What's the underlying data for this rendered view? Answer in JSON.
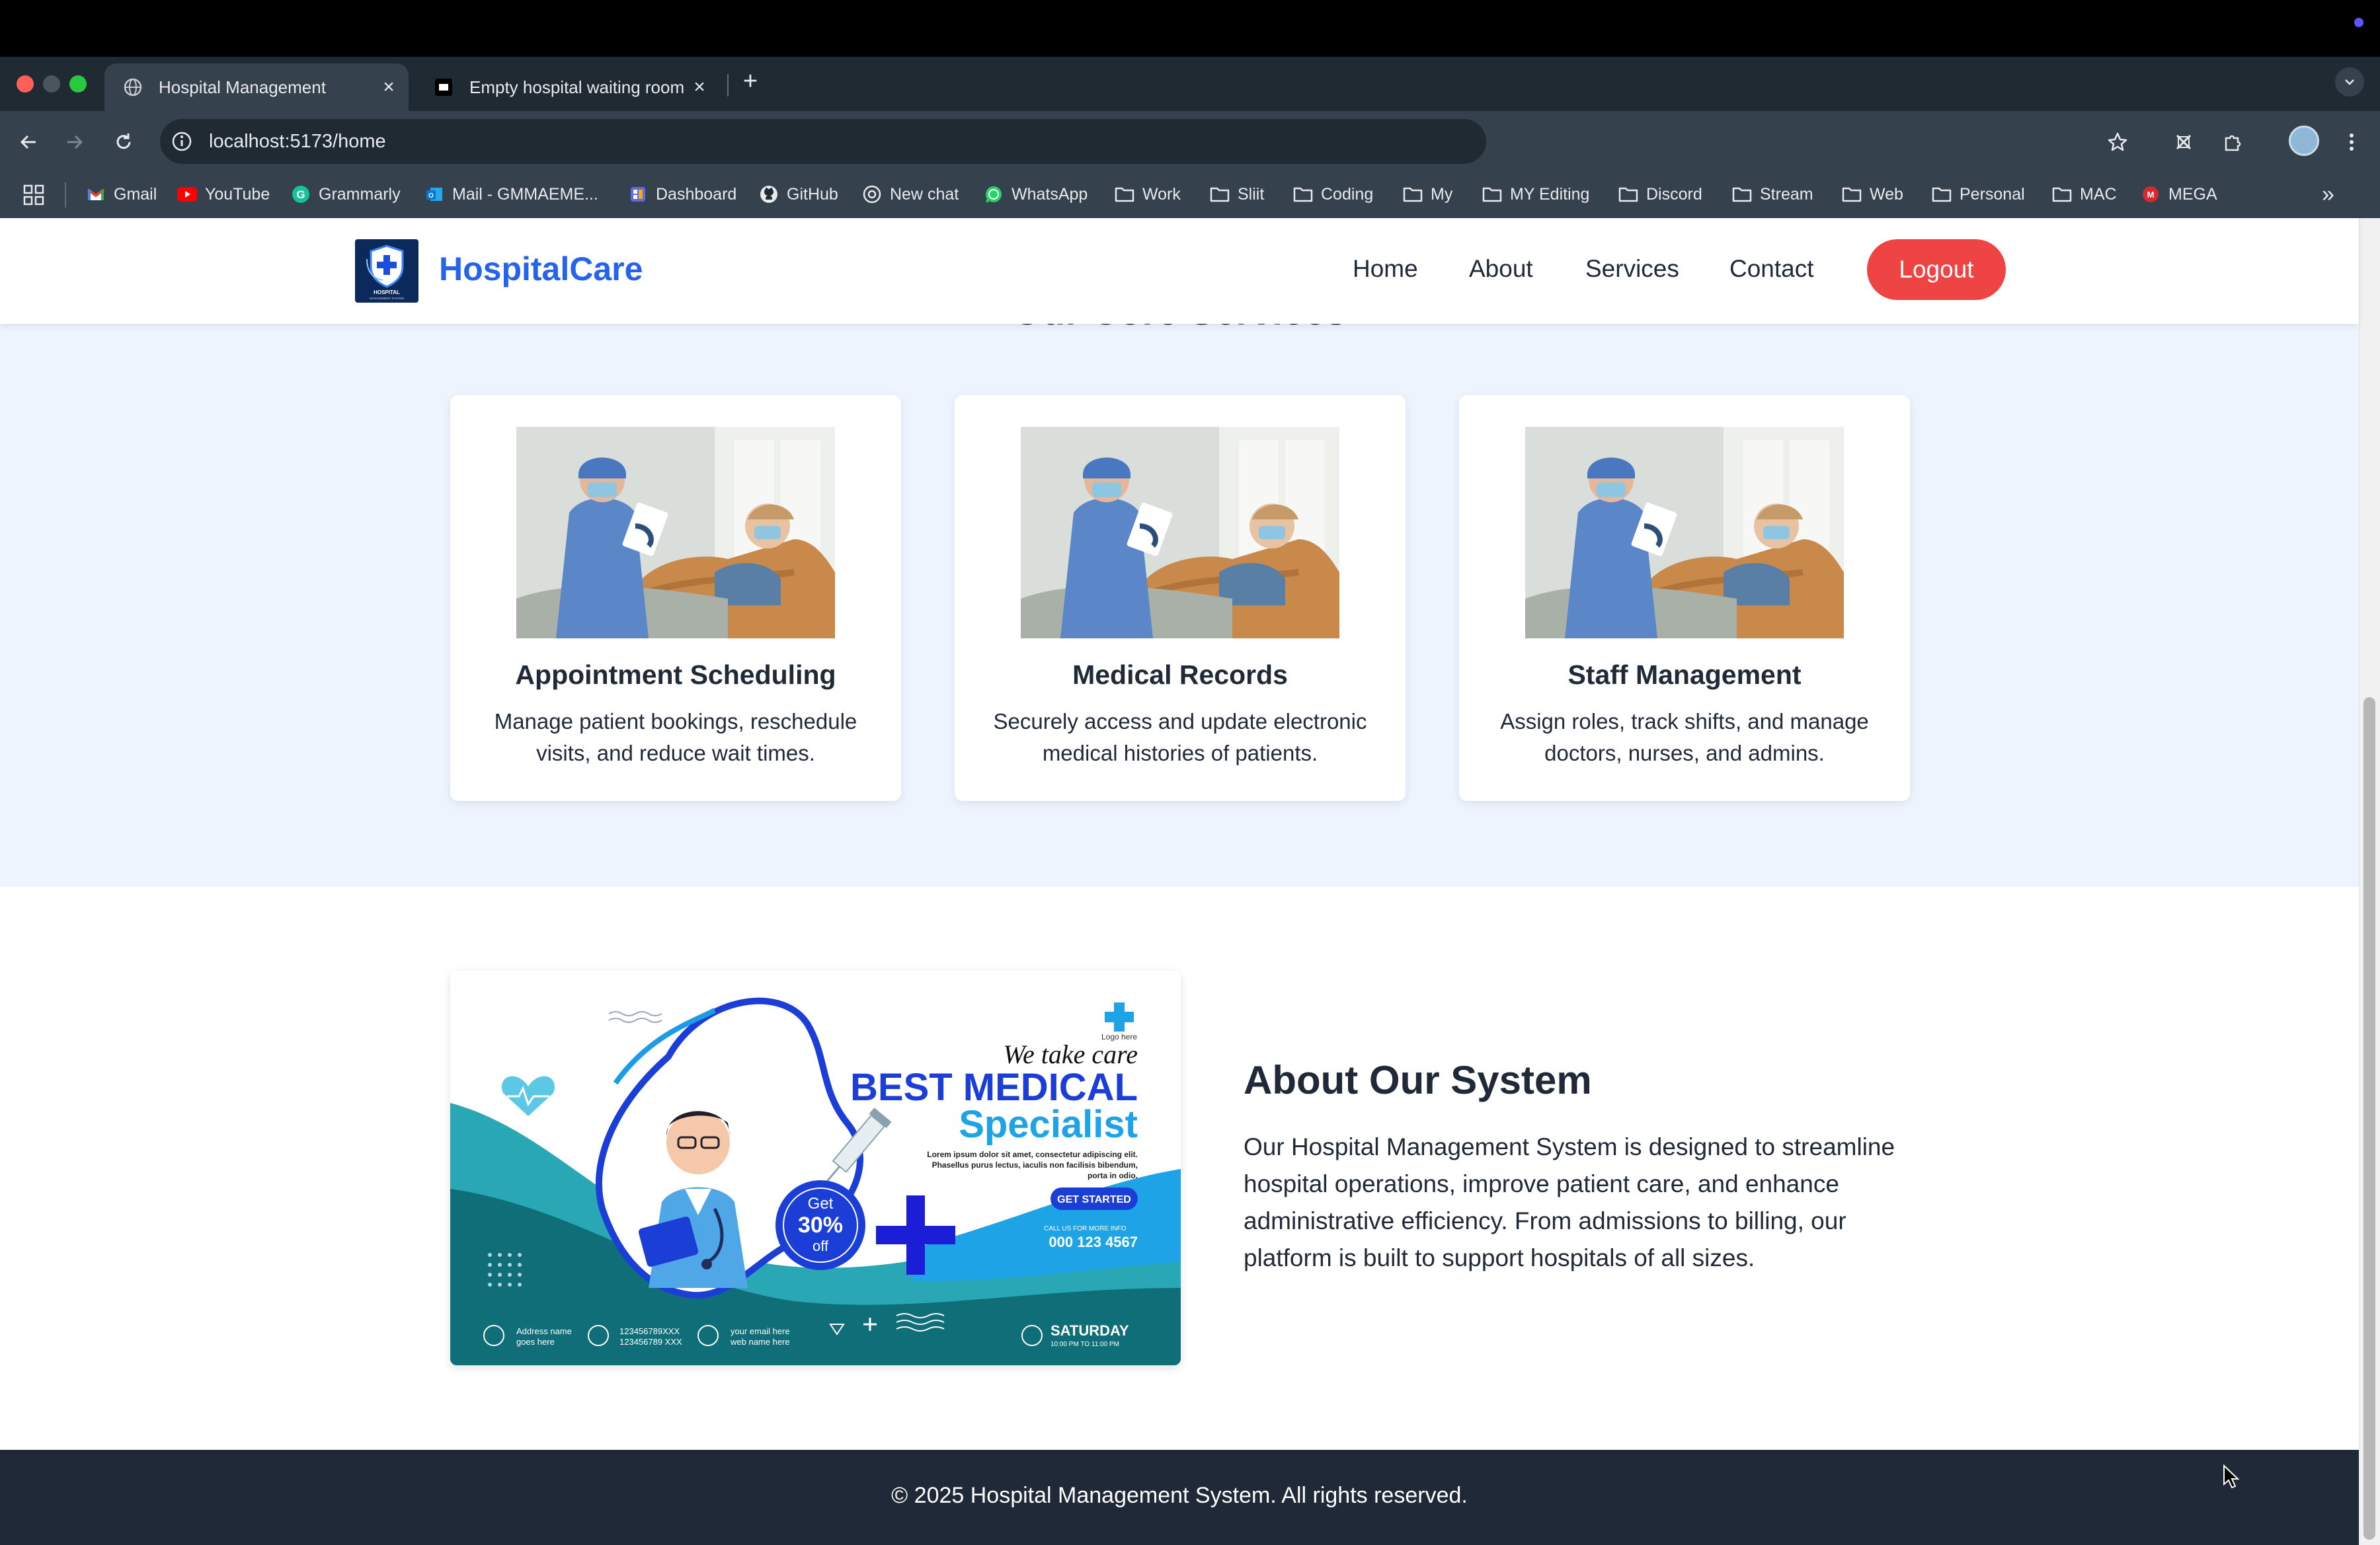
{
  "browser": {
    "tabs": [
      {
        "title": "Hospital Management",
        "active": true
      },
      {
        "title": "Empty hospital waiting room",
        "active": false
      }
    ],
    "new_tab_label": "+",
    "url": "localhost:5173/home",
    "bookmarks": [
      {
        "label": "Gmail",
        "icon": "gmail-icon"
      },
      {
        "label": "YouTube",
        "icon": "youtube-icon"
      },
      {
        "label": "Grammarly",
        "icon": "grammarly-icon"
      },
      {
        "label": "Mail - GMMAEME...",
        "icon": "outlook-icon"
      },
      {
        "label": "Dashboard",
        "icon": "dashboard-icon"
      },
      {
        "label": "GitHub",
        "icon": "github-icon"
      },
      {
        "label": "New chat",
        "icon": "chatgpt-icon"
      },
      {
        "label": "WhatsApp",
        "icon": "whatsapp-icon"
      },
      {
        "label": "Work",
        "icon": "folder-icon"
      },
      {
        "label": "Sliit",
        "icon": "folder-icon"
      },
      {
        "label": "Coding",
        "icon": "folder-icon"
      },
      {
        "label": "My",
        "icon": "folder-icon"
      },
      {
        "label": "MY Editing",
        "icon": "folder-icon"
      },
      {
        "label": "Discord",
        "icon": "folder-icon"
      },
      {
        "label": "Stream",
        "icon": "folder-icon"
      },
      {
        "label": "Web",
        "icon": "folder-icon"
      },
      {
        "label": "Personal",
        "icon": "folder-icon"
      },
      {
        "label": "MAC",
        "icon": "folder-icon"
      },
      {
        "label": "MEGA",
        "icon": "mega-icon"
      }
    ],
    "overflow_label": "»"
  },
  "header": {
    "logo_text": "HOSPITAL",
    "logo_subtext": "MANAGEMENT SYSTEM",
    "brand": "HospitalCare",
    "nav": [
      "Home",
      "About",
      "Services",
      "Contact"
    ],
    "logout_label": "Logout"
  },
  "services": {
    "section_title": "Our Core Services",
    "cards": [
      {
        "title": "Appointment Scheduling",
        "description": "Manage patient bookings, reschedule visits, and reduce wait times."
      },
      {
        "title": "Medical Records",
        "description": "Securely access and update electronic medical histories of patients."
      },
      {
        "title": "Staff Management",
        "description": "Assign roles, track shifts, and manage doctors, nurses, and admins."
      }
    ]
  },
  "about": {
    "title": "About Our System",
    "text": "Our Hospital Management System is designed to streamline hospital operations, improve patient care, and enhance administrative efficiency. From admissions to billing, our platform is built to support hospitals of all sizes.",
    "banner": {
      "logo_label": "Logo here",
      "tagline": "We take care",
      "headline_1": "BEST MEDICAL",
      "headline_2": "Specialist",
      "lorem_1": "Lorem ipsum dolor sit amet, consectetur adipiscing elit.",
      "lorem_2": "Phasellus purus lectus, iaculis non facilisis bibendum,",
      "lorem_3": "porta in odio.",
      "cta": "GET STARTED",
      "call_label": "CALL US FOR MORE INFO",
      "phone": "000 123 4567",
      "offer_1": "Get",
      "offer_2": "30%",
      "offer_3": "off",
      "address_1": "Address name",
      "address_2": "goes here",
      "phone_list_1": "123456789XXX",
      "phone_list_2": "123456789 XXX",
      "email_1": "your email here",
      "email_2": "web name here",
      "day": "SATURDAY",
      "hours": "10:00 PM TO 11:00 PM"
    }
  },
  "footer": {
    "text": "© 2025 Hospital Management System. All rights reserved."
  },
  "colors": {
    "brand_blue": "#2563eb",
    "logout_red": "#ef4444",
    "services_bg": "#eef4fd",
    "footer_bg": "#1f2937",
    "text_dark": "#1f2937"
  }
}
